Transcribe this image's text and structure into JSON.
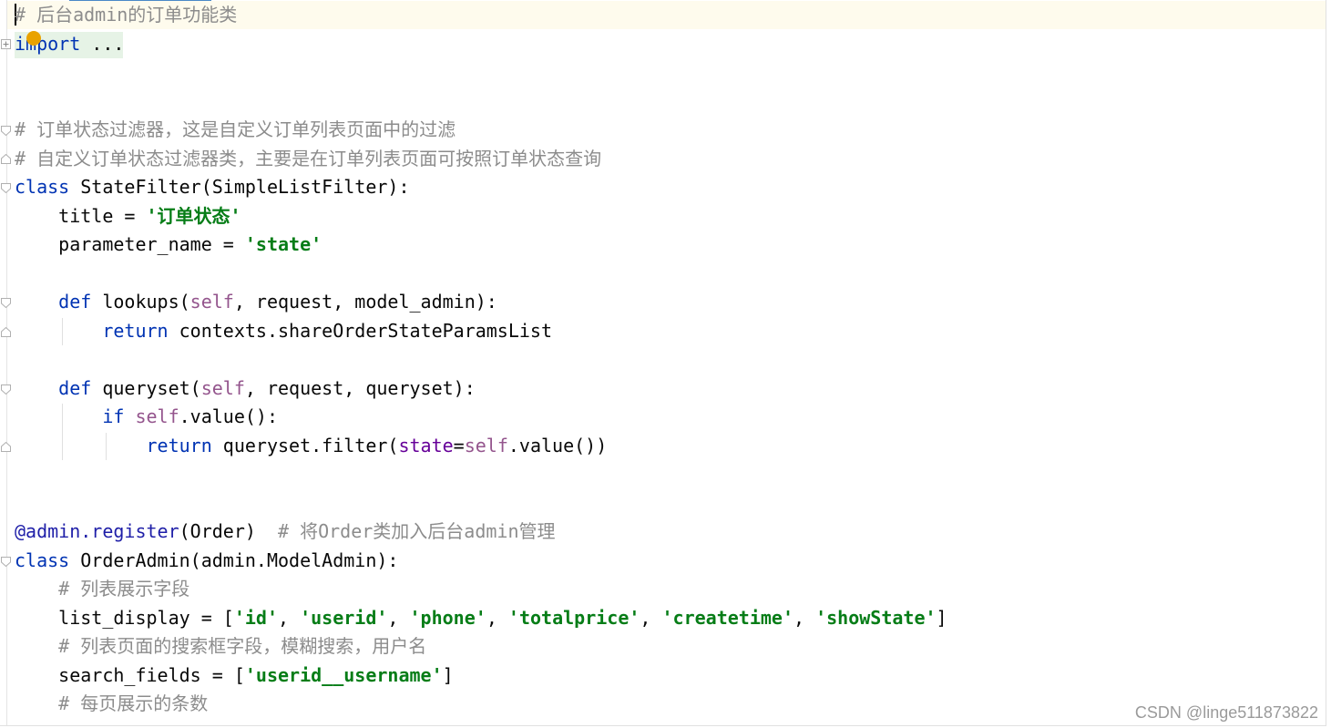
{
  "colors": {
    "keyword": "#0033b3",
    "string": "#067d17",
    "self": "#94558d",
    "comment": "#8c8c8c",
    "param": "#660099",
    "decorator": "#1f1fa8",
    "current_line": "#fefbed"
  },
  "code": {
    "l1": {
      "comment": "# 后台admin的订单功能类"
    },
    "l2": {
      "import_kw": "import",
      "import_rest": " ..."
    },
    "l5": {
      "comment": "# 订单状态过滤器，这是自定义订单列表页面中的过滤"
    },
    "l6": {
      "comment": "# 自定义订单状态过滤器类，主要是在订单列表页面可按照订单状态查询"
    },
    "l7": {
      "kw": "class",
      "rest": " StateFilter(SimpleListFilter):"
    },
    "l8": {
      "indent": "    ",
      "name": "title = ",
      "str": "'订单状态'"
    },
    "l9": {
      "indent": "    ",
      "name": "parameter_name = ",
      "str": "'state'"
    },
    "l11": {
      "indent": "    ",
      "kw": "def",
      "a": " lookups(",
      "self": "self",
      "b": ", request, model_admin):"
    },
    "l12": {
      "indent": "        ",
      "kw": "return",
      "rest": " contexts.shareOrderStateParamsList"
    },
    "l14": {
      "indent": "    ",
      "kw": "def",
      "a": " queryset(",
      "self": "self",
      "b": ", request, queryset):"
    },
    "l15": {
      "indent": "        ",
      "kw": "if",
      "sp": " ",
      "self": "self",
      "rest": ".value():"
    },
    "l16": {
      "indent": "            ",
      "kw": "return",
      "a": " queryset.filter(",
      "param": "state",
      "eq": "=",
      "self": "self",
      "b": ".value())"
    },
    "l19": {
      "deco": "@admin.register",
      "args": "(Order)",
      "comment": "  # 将Order类加入后台admin管理"
    },
    "l20": {
      "kw": "class",
      "rest": " OrderAdmin(admin.ModelAdmin):"
    },
    "l21": {
      "indent": "    ",
      "comment": "# 列表展示字段"
    },
    "l22": {
      "indent": "    ",
      "a": "list_display = [",
      "s1": "'id'",
      "c1": ", ",
      "s2": "'userid'",
      "c2": ", ",
      "s3": "'phone'",
      "c3": ", ",
      "s4": "'totalprice'",
      "c4": ", ",
      "s5": "'createtime'",
      "c5": ", ",
      "s6": "'showState'",
      "b": "]"
    },
    "l23": {
      "indent": "    ",
      "comment": "# 列表页面的搜索框字段，模糊搜索，用户名"
    },
    "l24": {
      "indent": "    ",
      "a": "search_fields = [",
      "s1": "'userid__username'",
      "b": "]"
    },
    "l25": {
      "indent": "    ",
      "comment": "# 每页展示的条数"
    }
  },
  "watermark": "CSDN @linge511873822"
}
